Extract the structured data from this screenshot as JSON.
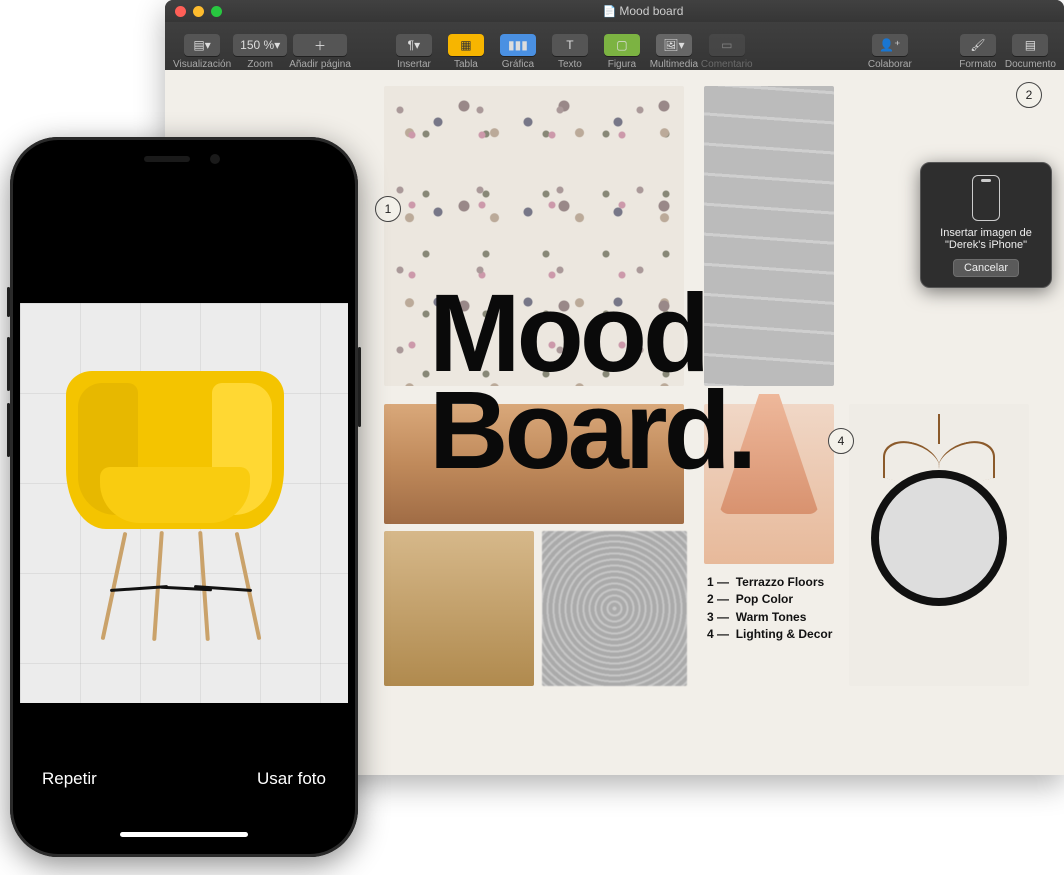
{
  "window": {
    "title": "Mood board"
  },
  "toolbar": {
    "view": "Visualización",
    "zoom_value": "150 %",
    "zoom": "Zoom",
    "add_page": "Añadir página",
    "insert": "Insertar",
    "table": "Tabla",
    "chart": "Gráfica",
    "text": "Texto",
    "shape": "Figura",
    "media": "Multimedia",
    "comment": "Comentario",
    "collab": "Colaborar",
    "format": "Formato",
    "document": "Documento"
  },
  "doc": {
    "title_line1": "Mood",
    "title_line2": "Board.",
    "callouts": {
      "c1": "1",
      "c2": "2",
      "c4": "4"
    },
    "legend": [
      {
        "n": "1",
        "t": "Terrazzo Floors"
      },
      {
        "n": "2",
        "t": "Pop Color"
      },
      {
        "n": "3",
        "t": "Warm Tones"
      },
      {
        "n": "4",
        "t": "Lighting & Decor"
      }
    ]
  },
  "popover": {
    "text": "Insertar imagen de \"Derek's iPhone\"",
    "cancel": "Cancelar"
  },
  "iphone": {
    "retake": "Repetir",
    "use": "Usar foto"
  }
}
